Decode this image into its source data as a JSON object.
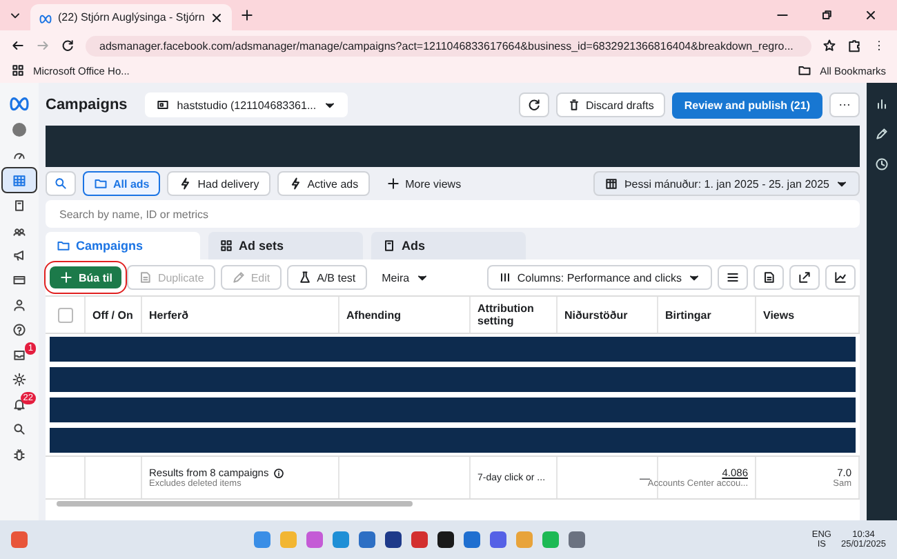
{
  "browser": {
    "tab_title": "(22) Stjórn Auglýsinga - Stjórn",
    "url": "adsmanager.facebook.com/adsmanager/manage/campaigns?act=1211046833617664&business_id=6832921366816404&breakdown_regro...",
    "bookmarks": [
      {
        "label": "Microsoft Office Ho..."
      }
    ],
    "all_bookmarks": "All Bookmarks"
  },
  "left_nav": [
    {
      "kind": "gauge",
      "selected": false
    },
    {
      "kind": "table",
      "selected": true
    },
    {
      "kind": "pages",
      "selected": false
    },
    {
      "kind": "people",
      "selected": false
    },
    {
      "kind": "megaphone",
      "selected": false
    },
    {
      "kind": "card",
      "selected": false
    },
    {
      "kind": "person",
      "selected": false
    },
    {
      "kind": "help",
      "selected": false
    },
    {
      "kind": "inbox",
      "selected": false,
      "badge": "1"
    },
    {
      "kind": "gear",
      "selected": false
    },
    {
      "kind": "bell",
      "selected": false,
      "badge": "22"
    },
    {
      "kind": "search",
      "selected": false
    },
    {
      "kind": "bug",
      "selected": false
    }
  ],
  "header": {
    "title": "Campaigns",
    "account": "haststudio (121104683361...",
    "discard": "Discard drafts",
    "publish": "Review and publish (21)"
  },
  "views": [
    {
      "label": "All ads",
      "selected": true
    },
    {
      "label": "Had delivery",
      "selected": false
    },
    {
      "label": "Active ads",
      "selected": false
    }
  ],
  "more_views": "More views",
  "date_range": "Þessi mánuður: 1. jan 2025 - 25. jan 2025",
  "search": {
    "placeholder": "Search by name, ID or metrics"
  },
  "level_tabs": [
    {
      "label": "Campaigns",
      "selected": true
    },
    {
      "label": "Ad sets",
      "selected": false
    },
    {
      "label": "Ads",
      "selected": false
    }
  ],
  "toolbar": {
    "create": "Búa til",
    "duplicate": "Duplicate",
    "edit": "Edit",
    "ab_test": "A/B test",
    "more": "Meira",
    "columns": "Columns: Performance and clicks"
  },
  "table": {
    "all_checked": false,
    "columns": [
      "Off / On",
      "Herferð",
      "Afhending",
      "Attribution setting",
      "Niðurstöður",
      "Birtingar",
      "Views"
    ],
    "redacted_rows": [
      {
        "kind": "redacted"
      },
      {
        "kind": "redacted"
      },
      {
        "kind": "redacted"
      },
      {
        "kind": "redacted"
      }
    ],
    "summary": {
      "title": "Results from 8 campaigns",
      "note": "Excludes deleted items",
      "attribution": "7-day click or ...",
      "results": "—",
      "impressions": "4.086",
      "impressions_note": "Accounts Center accou...",
      "views": "7.0",
      "views_note": "Sam"
    }
  },
  "taskbar": {
    "lang": "ENG",
    "layout": "IS",
    "time": "10:34",
    "date": "25/01/2025"
  }
}
